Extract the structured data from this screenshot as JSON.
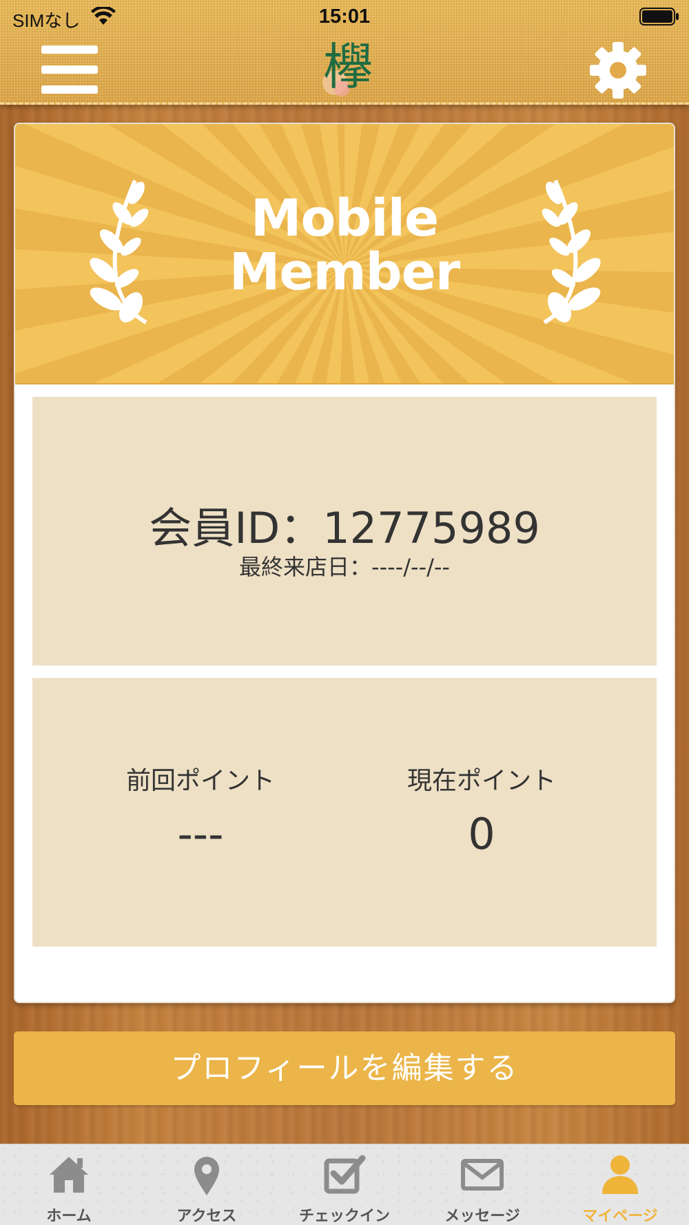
{
  "status_bar": {
    "carrier": "SIMなし",
    "time": "15:01"
  },
  "header": {
    "menu_icon": "hamburger-menu-icon",
    "logo_icon": "keyaki-kanji-logo",
    "logo_text": "欅",
    "settings_icon": "gear-icon"
  },
  "card": {
    "banner_title_line1": "Mobile",
    "banner_title_line2": "Member",
    "member_id_label": "会員ID：",
    "member_id": "12775989",
    "last_visit_label": "最終来店日：",
    "last_visit_value": "----/--/--",
    "previous_points_label": "前回ポイント",
    "previous_points_value": "---",
    "current_points_label": "現在ポイント",
    "current_points_value": "0"
  },
  "edit_profile_button": "プロフィールを編集する",
  "tabs": [
    {
      "label": "ホーム",
      "icon": "home-icon",
      "active": false
    },
    {
      "label": "アクセス",
      "icon": "location-pin-icon",
      "active": false
    },
    {
      "label": "チェックイン",
      "icon": "checkbox-icon",
      "active": false
    },
    {
      "label": "メッセージ",
      "icon": "envelope-icon",
      "active": false
    },
    {
      "label": "マイページ",
      "icon": "person-icon",
      "active": true
    }
  ],
  "colors": {
    "header": "#e6b04e",
    "banner": "#eeb84f",
    "panel": "#eee0c5",
    "button": "#ebb54a",
    "active_tab": "#efb43a",
    "inactive_tab": "#8c8c8c"
  }
}
